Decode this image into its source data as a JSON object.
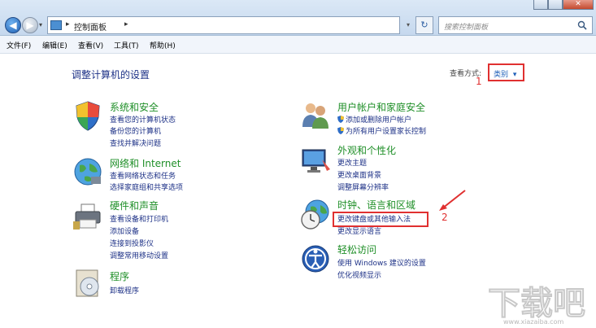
{
  "address_bar": {
    "path": "控制面板"
  },
  "search": {
    "placeholder": "搜索控制面板"
  },
  "menu": [
    "文件(F)",
    "编辑(E)",
    "查看(V)",
    "工具(T)",
    "帮助(H)"
  ],
  "page_title": "调整计算机的设置",
  "view_by": {
    "label": "查看方式:",
    "value": "类别"
  },
  "annotations": {
    "one": "1",
    "two": "2"
  },
  "colors": {
    "annotation": "#e03030",
    "category_title": "#1f8f28",
    "link": "#1e3287"
  },
  "categories_left": [
    {
      "title": "系统和安全",
      "icon": "shield-icon",
      "links": [
        "查看您的计算机状态",
        "备份您的计算机",
        "查找并解决问题"
      ]
    },
    {
      "title": "网络和 Internet",
      "icon": "globe-network-icon",
      "links": [
        "查看网络状态和任务",
        "选择家庭组和共享选项"
      ]
    },
    {
      "title": "硬件和声音",
      "icon": "printer-icon",
      "links": [
        "查看设备和打印机",
        "添加设备",
        "连接到投影仪",
        "调整常用移动设置"
      ]
    },
    {
      "title": "程序",
      "icon": "program-disc-icon",
      "links": [
        "卸载程序"
      ]
    }
  ],
  "categories_right": [
    {
      "title": "用户帐户和家庭安全",
      "icon": "users-icon",
      "links": [
        "添加或删除用户帐户",
        "为所有用户设置家长控制"
      ]
    },
    {
      "title": "外观和个性化",
      "icon": "monitor-icon",
      "links": [
        "更改主题",
        "更改桌面背景",
        "调整屏幕分辨率"
      ]
    },
    {
      "title": "时钟、语言和区域",
      "icon": "clock-globe-icon",
      "links": [
        "更改键盘或其他输入法",
        "更改显示语言"
      ]
    },
    {
      "title": "轻松访问",
      "icon": "accessibility-icon",
      "links": [
        "使用 Windows 建议的设置",
        "优化视频显示"
      ]
    }
  ],
  "watermark": {
    "text": "下载吧",
    "url": "www.xiazaiba.com"
  }
}
